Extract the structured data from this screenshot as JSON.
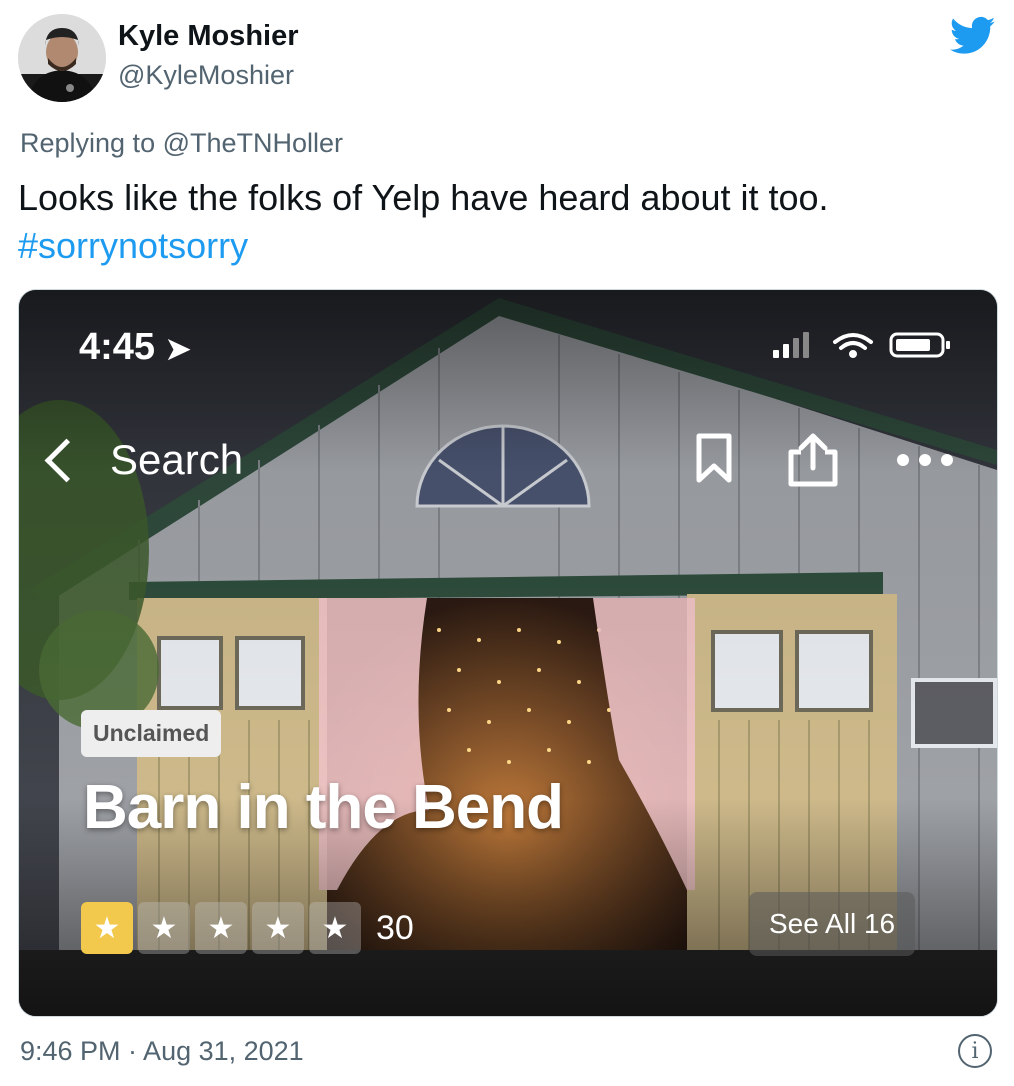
{
  "tweet": {
    "author_name": "Kyle Moshier",
    "author_handle": "@KyleMoshier",
    "replying_prefix": "Replying to ",
    "replying_to": "@TheTNHoller",
    "text": "Looks like the folks of Yelp have heard about it too.",
    "hashtag": "#sorrynotsorry",
    "timestamp": "9:46 PM · Aug 31, 2021",
    "brand_icon": "twitter-bird-icon",
    "brand_color": "#1d9bf0"
  },
  "screenshot": {
    "status_time": "4:45",
    "back_label": "Search",
    "badge": "Unclaimed",
    "business_name": "Barn in the Bend",
    "rating": 1,
    "rating_max": 5,
    "review_count": "30",
    "see_all_label": "See All 16",
    "star_color": "#f2c94c"
  }
}
